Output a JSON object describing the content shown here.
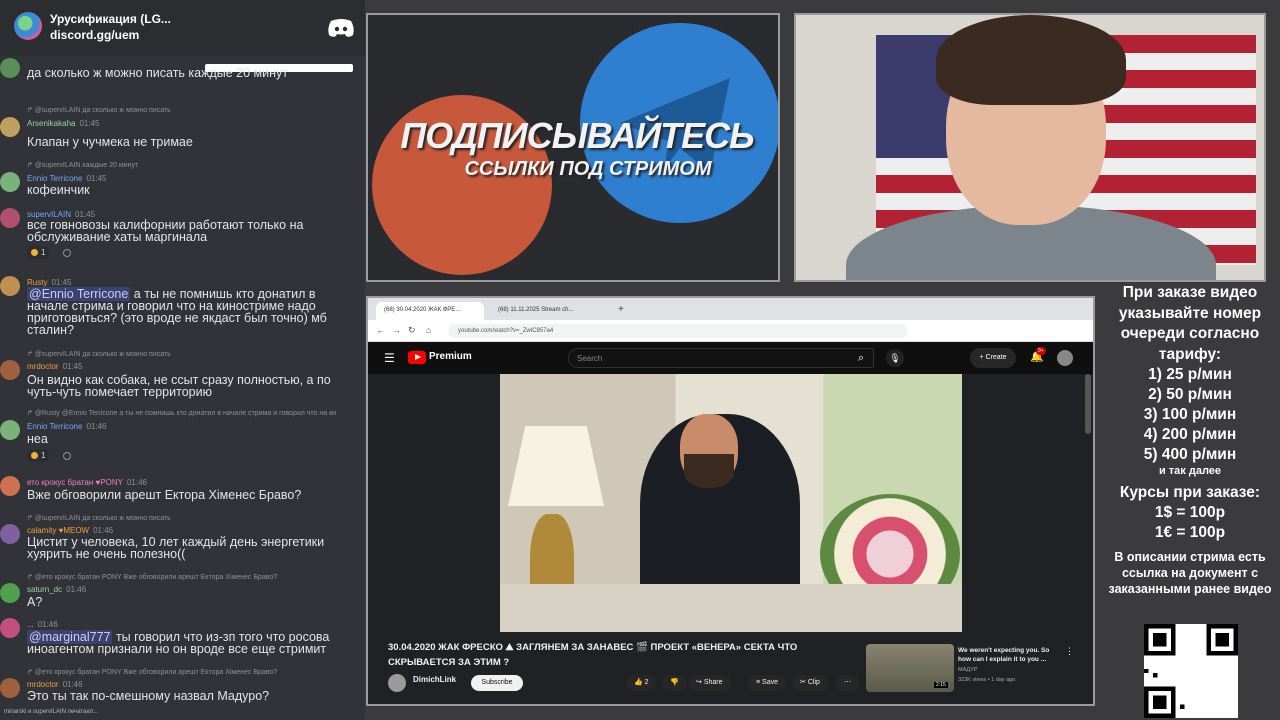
{
  "discord": {
    "server_name": "Урусификация (LG...",
    "invite": "discord.gg/uem",
    "typing": "minarski и supervILAIN печатают..."
  },
  "messages": [
    {
      "text": "да сколько ж можно писать каждые 20 минут",
      "avatar_color": "#5a8f5a"
    },
    {
      "reply": "@supervILAIN да сколько ж можно писать",
      "author": "Arsenikakaha",
      "author_color": "#9bd4a3",
      "time": "01:45",
      "text": "Клапан у чучмека не тримае",
      "avatar_color": "#c0a060"
    },
    {
      "reply": "@supervILAIN каждые 20 минут",
      "author": "Ennio Terricone",
      "author_color": "#70a8ff",
      "time": "01:45",
      "text": "кофеинчик",
      "avatar_color": "#7ab37a"
    },
    {
      "author": "supervILAIN",
      "author_color": "#70a8ff",
      "time": "01:45",
      "text": "все говновозы калифорнии работают только на обслуживание хаты маргинала",
      "reaction": "1",
      "avatar_color": "#b05070"
    },
    {
      "author": "Rusty",
      "author_color": "#f0a040",
      "time": "01:45",
      "mention": "@Ennio Terricone",
      "text": " а ты не помнишь кто донатил в начале стрима и говорил что на киностриме надо приготовиться? (это вроде не якдаст был точно) мб сталин?",
      "avatar_color": "#c09050"
    },
    {
      "reply": "@supervILAIN да сколько ж можно писать",
      "author": "mrdoctor",
      "author_color": "#f0a040",
      "time": "01:45",
      "text": "Он видно как собака, не ссыт сразу полностью, а по чуть-чуть помечает территорию",
      "avatar_color": "#a06040"
    },
    {
      "reply": "@Rusty @Ennio Terricone а ты не помнишь кто донатил в начале стрима и говорил что на ки",
      "author": "Ennio Terricone",
      "author_color": "#70a8ff",
      "time": "01:46",
      "text": "неа",
      "reaction": "1",
      "avatar_color": "#7ab37a"
    },
    {
      "author": "ето крокус братан",
      "author_color": "#f080c0",
      "badge": "PONY",
      "time": "01:46",
      "text": "Вже обговорили арешт Ектора Хіменес Браво?",
      "avatar_color": "#d07050"
    },
    {
      "reply": "@supervILAIN да сколько ж можно писать",
      "author": "calamity",
      "author_color": "#f0a040",
      "badge": "MEOW",
      "time": "01:46",
      "text": "Цистит у человека, 10 лет каждый день энергетики хуярить не очень полезно((",
      "avatar_color": "#8060a0"
    },
    {
      "reply": "@ето крокус братан PONY Вже обговорили арешт Ектора Хіменес Браво?",
      "author": "saturn_dc",
      "author_color": "#9bd4a3",
      "time": "01:46",
      "text": "А?",
      "avatar_color": "#50a050"
    },
    {
      "author": "...",
      "author_color": "#9bd4a3",
      "time": "01:46",
      "mention": "@marginal777",
      "text": " ты говорил что из-зп того что росова иноагентом признали но он вроде все еще стримит",
      "avatar_color": "#c05080"
    },
    {
      "reply": "@ето крокус братан PONY Вже обговорили арешт Ектора Хіменес Браво?",
      "author": "mrdoctor",
      "author_color": "#f0a040",
      "time": "01:46",
      "text": "Это ты так по-смешному назвал Мадуро?",
      "avatar_color": "#a06040"
    }
  ],
  "promo": {
    "title": "ПОДПИСЫВАЙТЕСЬ",
    "subtitle": "ССЫЛКИ ПОД СТРИМОМ"
  },
  "browser": {
    "tab1": "(68) 30.04.2020 ЖАК ФРЕ...",
    "tab2": "(68) 11.11.2025 Stream ch...",
    "url": "youtube.com/watch?v=_ZwlC857a4",
    "yt_brand": "Premium",
    "search_placeholder": "Search",
    "create_label": "Create",
    "notif_count": "9+",
    "video_title": "30.04.2020 ЖАК ФРЕСКО ⛰ ЗАГЛЯНЕМ ЗА ЗАНАВЕС 🎬 ПРОЕКТ «ВЕНЕРА» СЕКТА ЧТО СКРЫВАЕТСЯ ЗА ЭТИМ ?",
    "channel": "DimichLink",
    "subscribe": "Subscribe",
    "likes": "2",
    "share": "Share",
    "save": "Save",
    "clip": "Clip",
    "rec_title": "We weren't expecting you. So how can I explain it to you ...",
    "rec_channel": "МАДУР",
    "rec_meta": "323K views • 1 day ago",
    "rec_duration": "2:15"
  },
  "info": {
    "head": "При заказе видео указывайте номер очереди согласно тарифу:",
    "tariffs": [
      "1) 25 р/мин",
      "2) 50 р/мин",
      "3) 100 р/мин",
      "4) 200 р/мин",
      "5) 400 р/мин"
    ],
    "etc": "и так далее",
    "courses_head": "Курсы при заказе:",
    "courses": [
      "1$ = 100р",
      "1€ = 100р"
    ],
    "desc": "В описании стрима есть ссылка на документ с заказанными ранее видео"
  }
}
